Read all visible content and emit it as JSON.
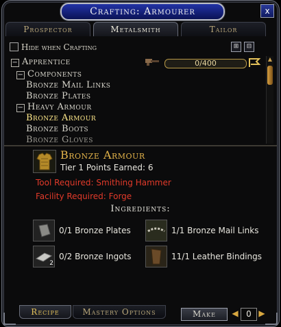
{
  "window": {
    "title": "Crafting: Armourer",
    "close_label": "x"
  },
  "tabs": [
    {
      "label": "Prospector",
      "active": false
    },
    {
      "label": "Metalsmith",
      "active": true
    },
    {
      "label": "Tailor",
      "active": false
    }
  ],
  "options": {
    "hide_when_crafting": "Hide when Crafting"
  },
  "tree": {
    "tier_label": "Apprentice",
    "progress_text": "0/400",
    "progress_fraction": 0.0,
    "rows": [
      {
        "label": "Components",
        "type": "category"
      },
      {
        "label": "Bronze Mail Links",
        "type": "item"
      },
      {
        "label": "Bronze Plates",
        "type": "item"
      },
      {
        "label": "Heavy Armour",
        "type": "category"
      },
      {
        "label": "Bronze Armour",
        "type": "item-selected"
      },
      {
        "label": "Bronze Boots",
        "type": "item"
      },
      {
        "label": "Bronze Gloves",
        "type": "item"
      }
    ]
  },
  "recipe": {
    "name": "Bronze Armour",
    "tier_points": "Tier 1 Points Earned: 6",
    "tool_required": "Tool Required: Smithing Hammer",
    "facility_required": "Facility Required: Forge",
    "ingredients_header": "Ingredients:",
    "ingredients": [
      {
        "text": "0/1 Bronze Plates",
        "icon": "bronze-plate-icon",
        "qty": ""
      },
      {
        "text": "1/1 Bronze Mail Links",
        "icon": "mail-links-icon",
        "qty": ""
      },
      {
        "text": "0/2 Bronze Ingots",
        "icon": "bronze-ingot-icon",
        "qty": "2"
      },
      {
        "text": "11/1 Leather Bindings",
        "icon": "leather-bindings-icon",
        "qty": ""
      }
    ]
  },
  "footer": {
    "recipe_tab": "Recipe",
    "mastery_tab": "Mastery Options",
    "make_label": "Make",
    "make_count": "0"
  },
  "colors": {
    "gold": "#e3b34a",
    "required_red": "#e23a2a",
    "title_blue": "#1a2a9a"
  }
}
